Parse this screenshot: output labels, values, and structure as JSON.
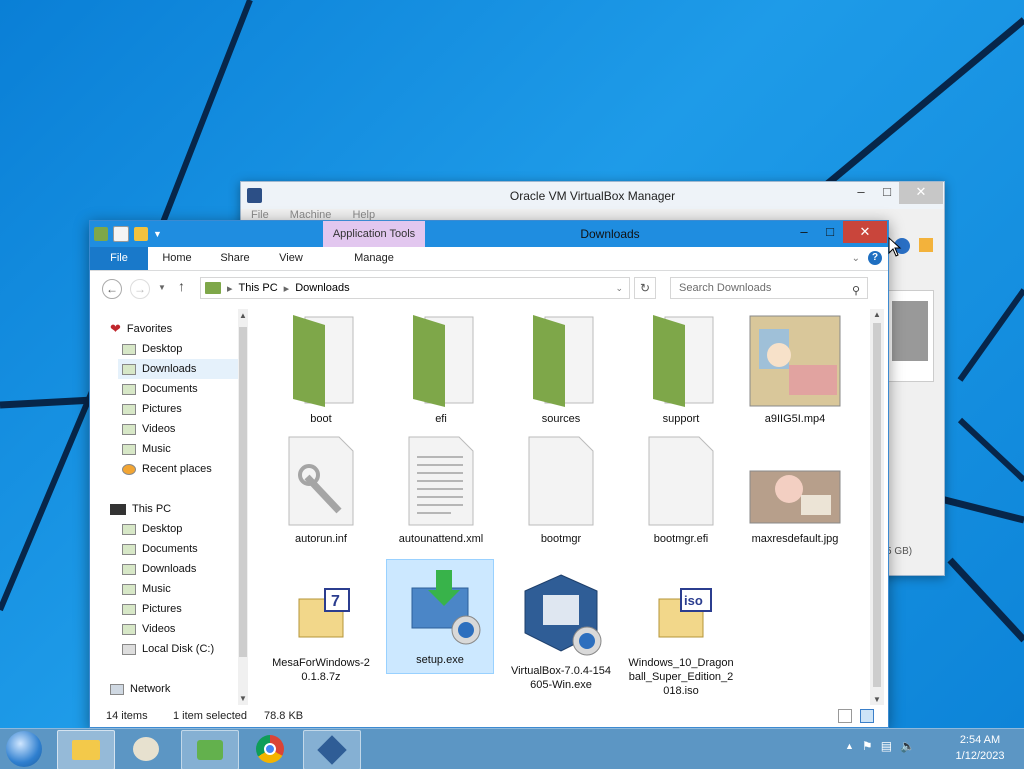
{
  "virtualbox": {
    "title": "Oracle VM VirtualBox Manager",
    "menu": [
      "File",
      "Machine",
      "Help"
    ],
    "size_fragment": "5 GB)"
  },
  "explorer": {
    "title": "Downloads",
    "contextual_tab": "Application Tools",
    "ribbon_tabs": {
      "file": "File",
      "home": "Home",
      "share": "Share",
      "view": "View",
      "manage": "Manage"
    },
    "address": {
      "root": "This PC",
      "current": "Downloads"
    },
    "search_placeholder": "Search Downloads",
    "navigation": {
      "favorites_label": "Favorites",
      "favorites": [
        "Desktop",
        "Downloads",
        "Documents",
        "Pictures",
        "Videos",
        "Music",
        "Recent places"
      ],
      "thispc_label": "This PC",
      "thispc": [
        "Desktop",
        "Documents",
        "Downloads",
        "Music",
        "Pictures",
        "Videos",
        "Local Disk (C:)"
      ],
      "network_label": "Network",
      "selected": "Downloads"
    },
    "files": [
      {
        "name": "boot",
        "icon": "folder-icon"
      },
      {
        "name": "efi",
        "icon": "folder-icon"
      },
      {
        "name": "sources",
        "icon": "folder-icon"
      },
      {
        "name": "support",
        "icon": "folder-icon"
      },
      {
        "name": "a9IIG5I.mp4",
        "icon": "video-thumbnail"
      },
      {
        "name": "autorun.inf",
        "icon": "settings-file-icon"
      },
      {
        "name": "autounattend.xml",
        "icon": "text-file-icon"
      },
      {
        "name": "bootmgr",
        "icon": "blank-file-icon"
      },
      {
        "name": "bootmgr.efi",
        "icon": "blank-file-icon"
      },
      {
        "name": "maxresdefault.jpg",
        "icon": "image-thumbnail"
      },
      {
        "name": "MesaForWindows-20.1.8.7z",
        "icon": "archive-7z-icon"
      },
      {
        "name": "setup.exe",
        "icon": "setup-installer-icon",
        "selected": true
      },
      {
        "name": "VirtualBox-7.0.4-154605-Win.exe",
        "icon": "virtualbox-installer-icon"
      },
      {
        "name": "Windows_10_Dragonball_Super_Edition_2018.iso",
        "icon": "iso-archive-icon"
      }
    ],
    "status": {
      "count": "14 items",
      "selected": "1 item selected",
      "size": "78.8 KB"
    }
  },
  "taskbar": {
    "apps": [
      "file-explorer-icon",
      "paint-icon",
      "people-icon",
      "chrome-icon",
      "virtualbox-icon"
    ],
    "time": "2:54 AM",
    "date": "1/12/2023"
  },
  "colors": {
    "desktop": "#0a7fd6",
    "explorer_titlebar": "#1f8de0",
    "file_tab": "#1979ca",
    "close_button": "#c9453b",
    "contextual_tab": "#e2c7ef",
    "selection": "#cce8ff",
    "folder": "#7ea749"
  }
}
